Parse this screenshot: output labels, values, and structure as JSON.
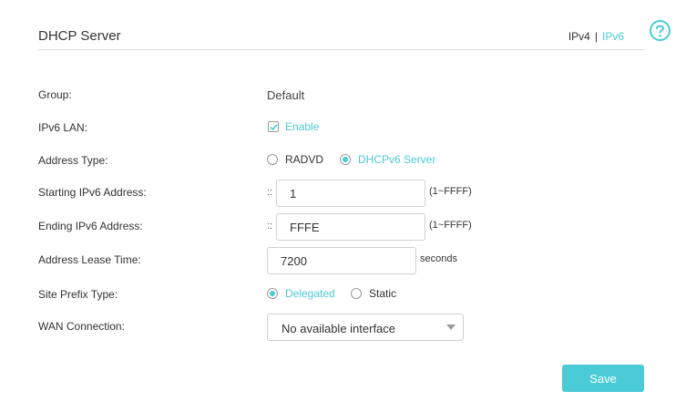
{
  "header": {
    "title": "DHCP Server",
    "ipv4_label": "IPv4",
    "separator": "|",
    "ipv6_label": "IPv6",
    "help_icon": "question-circle-icon"
  },
  "form": {
    "group": {
      "label": "Group:",
      "value": "Default"
    },
    "ipv6_lan": {
      "label": "IPv6 LAN:",
      "checkbox_label": "Enable",
      "checked": true
    },
    "address_type": {
      "label": "Address Type:",
      "options": [
        "RADVD",
        "DHCPv6 Server"
      ],
      "selected": "DHCPv6 Server"
    },
    "starting_address": {
      "label": "Starting IPv6 Address:",
      "prefix": "::",
      "value": "1",
      "hint": "(1~FFFF)"
    },
    "ending_address": {
      "label": "Ending IPv6 Address:",
      "prefix": "::",
      "value": "FFFE",
      "hint": "(1~FFFF)"
    },
    "lease_time": {
      "label": "Address Lease Time:",
      "value": "7200",
      "unit": "seconds"
    },
    "site_prefix_type": {
      "label": "Site Prefix Type:",
      "options": [
        "Delegated",
        "Static"
      ],
      "selected": "Delegated"
    },
    "wan_connection": {
      "label": "WAN Connection:",
      "value": "No available interface"
    }
  },
  "actions": {
    "save_label": "Save"
  },
  "colors": {
    "accent": "#4acbd6",
    "text": "#333333",
    "border": "#d0d0d0"
  }
}
